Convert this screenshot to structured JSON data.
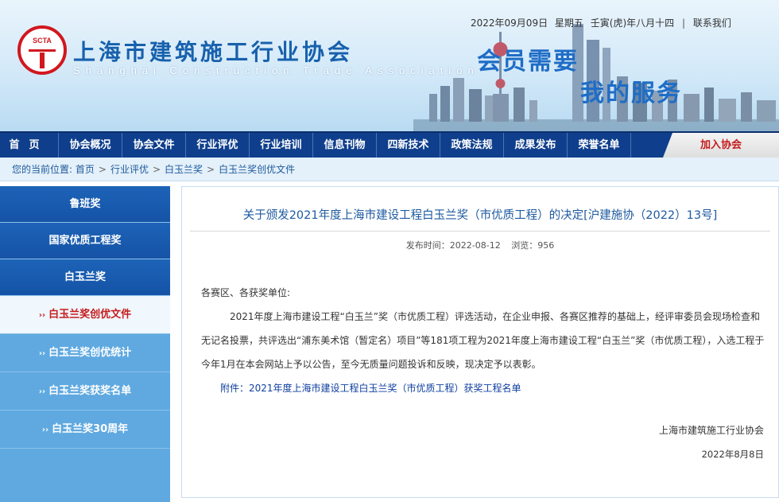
{
  "header": {
    "logo_text": "SCTA",
    "org_name": "上海市建筑施工行业协会",
    "org_name_en": "Shanghai Construction Trade Association",
    "date": "2022年09月09日",
    "weekday": "星期五",
    "lunar": "壬寅(虎)年八月十四",
    "contact_link": "联系我们",
    "slogan_line1": "会员需要",
    "slogan_line2": "我的服务"
  },
  "nav": {
    "items": [
      "首页",
      "协会概况",
      "协会文件",
      "行业评优",
      "行业培训",
      "信息刊物",
      "四新技术",
      "政策法规",
      "成果发布",
      "荣誉名单"
    ],
    "join": "加入协会"
  },
  "breadcrumb": {
    "label": "您的当前位置:",
    "items": [
      "首页",
      "行业评优",
      "白玉兰奖",
      "白玉兰奖创优文件"
    ]
  },
  "sidebar": {
    "top_items": [
      "鲁班奖",
      "国家优质工程奖",
      "白玉兰奖"
    ],
    "sub_items": [
      "白玉兰奖创优文件",
      "白玉兰奖创优统计",
      "白玉兰奖获奖名单",
      "白玉兰奖30周年"
    ],
    "chevron": "››"
  },
  "article": {
    "title": "关于颁发2021年度上海市建设工程白玉兰奖（市优质工程）的决定[沪建施协（2022）13号]",
    "publish_label": "发布时间：",
    "publish_date": "2022-08-12",
    "views_label": "浏览：",
    "views": "956",
    "greeting": "各赛区、各获奖单位:",
    "paragraph": "2021年度上海市建设工程“白玉兰”奖（市优质工程）评选活动，在企业申报、各赛区推荐的基础上，经评审委员会现场检查和无记名投票，共评选出“浦东美术馆（暂定名）项目”等181项工程为2021年度上海市建设工程“白玉兰”奖（市优质工程），入选工程于今年1月在本会网站上予以公告，至今无质量问题投诉和反映，现决定予以表彰。",
    "attachment": "附件：2021年度上海市建设工程白玉兰奖（市优质工程）获奖工程名单",
    "sign_org": "上海市建筑施工行业协会",
    "sign_date": "2022年8月8日"
  },
  "colors": {
    "nav_bg": "#0f3f8c",
    "sidebar_top": "#1d63b8",
    "sidebar_sub": "#5fa9e0",
    "title_blue": "#1e5aa0",
    "active_red": "#c51c1c"
  }
}
